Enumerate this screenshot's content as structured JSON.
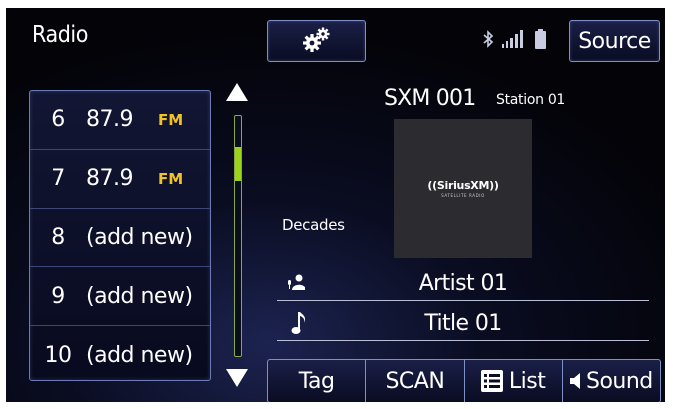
{
  "header": {
    "title": "Radio",
    "source_label": "Source"
  },
  "status_icons": [
    "bluetooth-icon",
    "signal-strength-icon",
    "battery-icon"
  ],
  "icons": {
    "settings": "gear-icon",
    "scroll_up": "triangle-up-icon",
    "scroll_down": "triangle-down-icon",
    "artist": "artist-icon",
    "title": "music-note-icon",
    "list": "list-icon",
    "sound": "speaker-icon"
  },
  "presets": [
    {
      "number": "6",
      "label": "87.9",
      "band": "FM"
    },
    {
      "number": "7",
      "label": "87.9",
      "band": "FM"
    },
    {
      "number": "8",
      "label": "(add new)",
      "band": ""
    },
    {
      "number": "9",
      "label": "(add new)",
      "band": ""
    },
    {
      "number": "10",
      "label": "(add new)",
      "band": ""
    }
  ],
  "scroll": {
    "position_fraction": 0.15
  },
  "now_playing": {
    "channel": "SXM 001",
    "station": "Station 01",
    "category": "Decades",
    "artist": "Artist 01",
    "song_title": "Title 01",
    "logo_text": "((SiriusXM))",
    "logo_subtext": "SATELLITE RADIO"
  },
  "bottom_buttons": {
    "tag": "Tag",
    "scan": "SCAN",
    "list": "List",
    "sound": "Sound"
  },
  "colors": {
    "band_label": "#f2c326",
    "scroll_thumb": "#9ad21c",
    "button_border": "#7f8fc8"
  }
}
